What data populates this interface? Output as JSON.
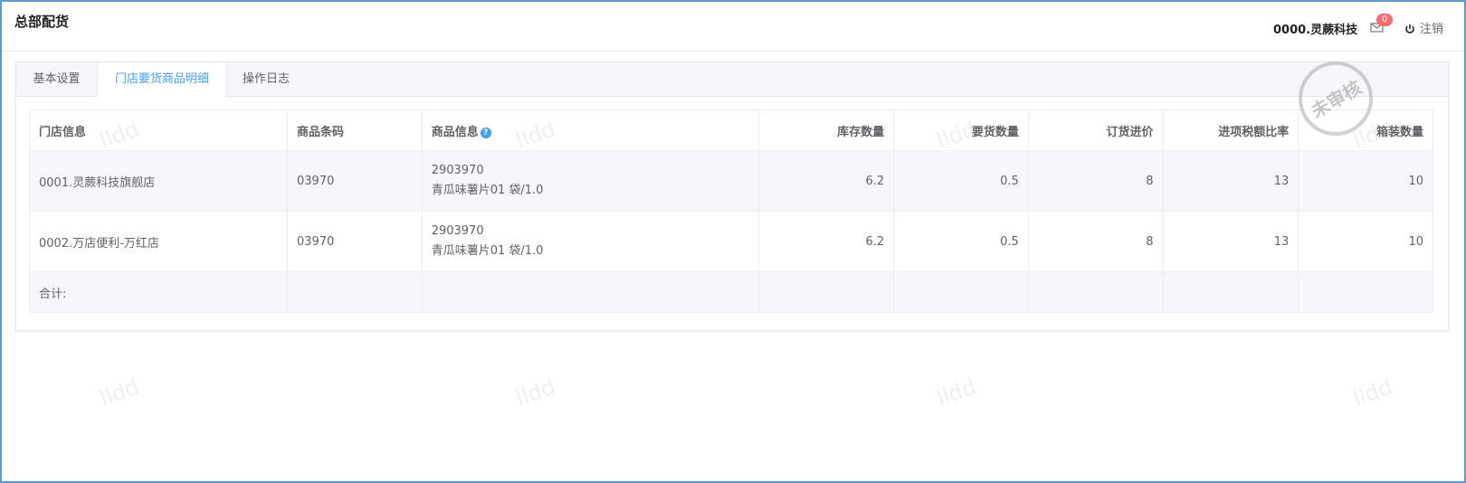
{
  "header": {
    "title": "总部配货",
    "org": "0000.灵蕨科技",
    "message_count": "0",
    "logout": "注销"
  },
  "tabs": [
    {
      "label": "基本设置"
    },
    {
      "label": "门店要货商品明细"
    },
    {
      "label": "操作日志"
    }
  ],
  "table": {
    "columns": [
      "门店信息",
      "商品条码",
      "商品信息",
      "库存数量",
      "要货数量",
      "订货进价",
      "进项税额比率",
      "箱装数量"
    ],
    "rows": [
      {
        "store": "0001.灵蕨科技旗舰店",
        "barcode": "03970",
        "item_code": "2903970",
        "item_name": "青瓜味薯片01 袋/1.0",
        "stock": "6.2",
        "request_qty": "0.5",
        "price": "8",
        "tax_rate": "13",
        "case_qty": "10"
      },
      {
        "store": "0002.万店便利-万红店",
        "barcode": "03970",
        "item_code": "2903970",
        "item_name": "青瓜味薯片01 袋/1.0",
        "stock": "6.2",
        "request_qty": "0.5",
        "price": "8",
        "tax_rate": "13",
        "case_qty": "10"
      }
    ],
    "total_label": "合计:"
  },
  "stamp": "未审核",
  "watermark": "lldd",
  "colors": {
    "accent": "#409eff",
    "badge": "#f56c6c",
    "frame": "#5b9bd5"
  }
}
